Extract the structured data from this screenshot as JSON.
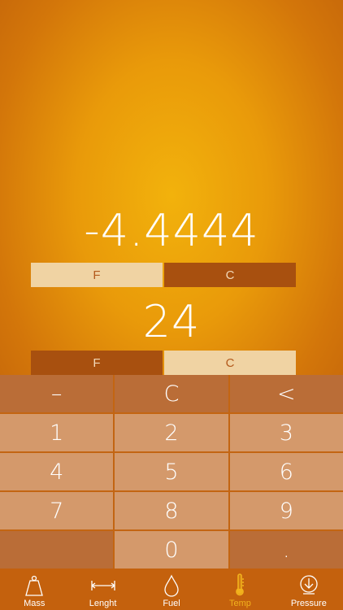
{
  "display": {
    "value1": "-4.4444",
    "value2": "24"
  },
  "units1": {
    "left": "F",
    "right": "C",
    "selected": "left"
  },
  "units2": {
    "left": "F",
    "right": "C",
    "selected": "right"
  },
  "keypad": {
    "minus": "–",
    "clear": "C",
    "back": "<",
    "k1": "1",
    "k2": "2",
    "k3": "3",
    "k4": "4",
    "k5": "5",
    "k6": "6",
    "k7": "7",
    "k8": "8",
    "k9": "9",
    "k0": "0",
    "dot": "."
  },
  "tabs": [
    {
      "label": "Mass",
      "icon": "weight-icon"
    },
    {
      "label": "Lenght",
      "icon": "ruler-icon"
    },
    {
      "label": "Fuel",
      "icon": "drop-icon"
    },
    {
      "label": "Temp",
      "icon": "thermometer-icon"
    },
    {
      "label": "Pressure",
      "icon": "pressure-icon"
    }
  ],
  "colors": {
    "active_tab": "#f2b21d",
    "accent_dark": "#a8500f",
    "accent_light": "#f0d3a3"
  }
}
